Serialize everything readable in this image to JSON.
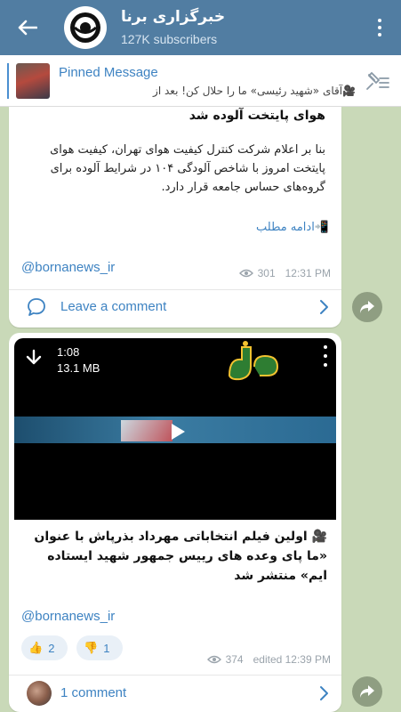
{
  "header": {
    "title": "خبرگزاری برنا",
    "subscribers": "127K subscribers"
  },
  "pinned": {
    "label": "Pinned Message",
    "text": "🎥آقای «شهید رئیسی» ما را حلال کن! بعد از اعلام..."
  },
  "messages": [
    {
      "heading": "هوای پایتخت آلوده شد",
      "body": "بنا بر اعلام شرکت کنترل کیفیت هوای تهران، کیفیت هوای پایتخت امروز با شاخص آلودگی ۱۰۴ در شرایط آلوده برای گروه‌های حساس جامعه قرار دارد.",
      "read_more": "📲ادامه مطلب",
      "handle": "@bornanews_ir",
      "views": "301",
      "time": "12:31 PM",
      "comment_label": "Leave a comment"
    },
    {
      "video": {
        "duration": "1:08",
        "size": "13.1 MB"
      },
      "caption": "🎥 اولین فیلم انتخاباتی مهرداد بذرپاش با عنوان «ما پای وعده های رییس جمهور شهید ایستاده ایم» منتشر شد",
      "handle": "@bornanews_ir",
      "reactions": [
        {
          "emoji": "👍",
          "count": "2"
        },
        {
          "emoji": "👎",
          "count": "1"
        }
      ],
      "views": "374",
      "time": "edited 12:39 PM",
      "comment_label": "1 comment"
    }
  ],
  "colors": {
    "header": "#517da2",
    "accent": "#3e83c2",
    "chat_bg": "#c9d9b8"
  },
  "icons": {
    "back": "arrow-left-icon",
    "menu": "more-vertical-icon",
    "pin": "pin-list-icon",
    "views": "eye-icon",
    "comment": "comment-bubble-icon",
    "chevron": "chevron-right-icon",
    "download": "download-icon",
    "play": "play-icon",
    "share": "share-arrow-icon"
  }
}
